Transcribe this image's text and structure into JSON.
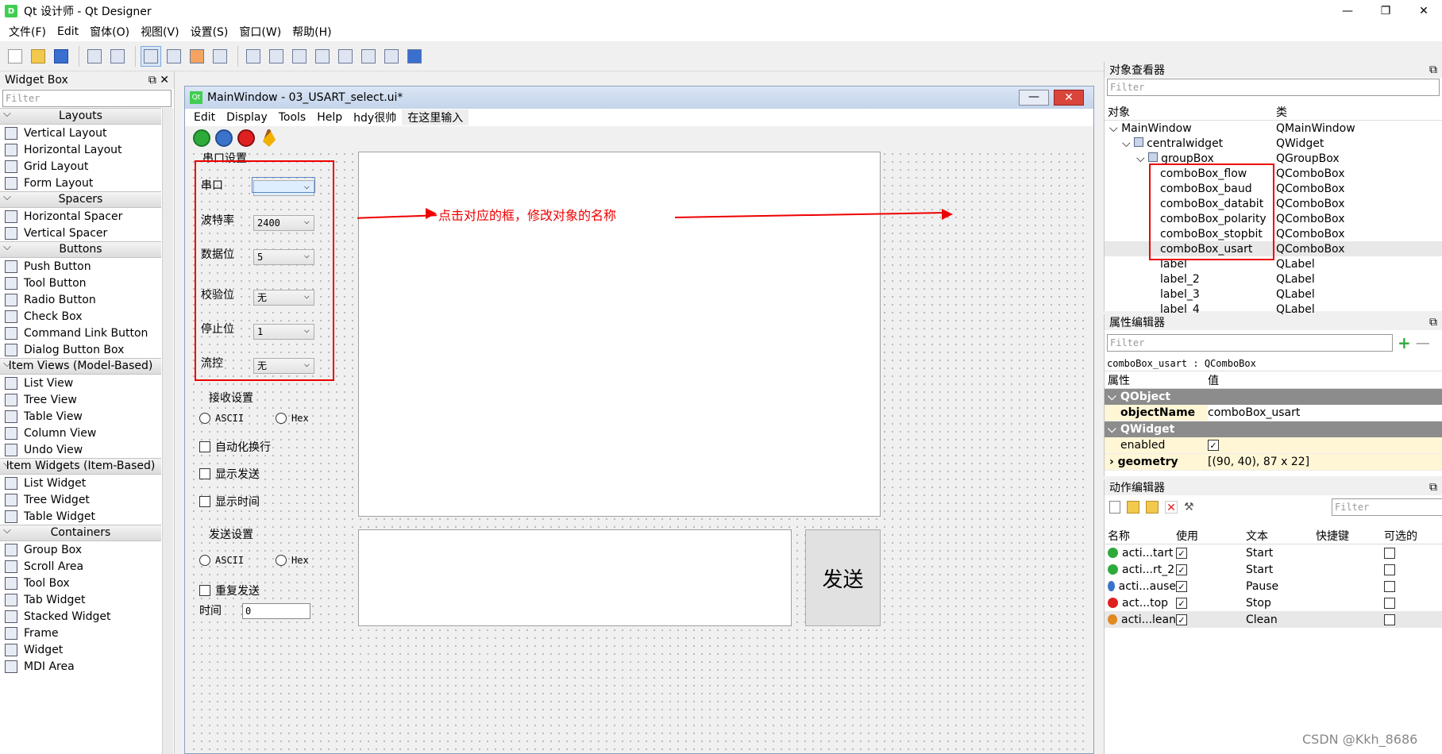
{
  "window": {
    "title": "Qt 设计师 - Qt Designer",
    "app_icon": "D",
    "minimize": "—",
    "maximize": "❐",
    "close": "✕"
  },
  "menubar": [
    "文件(F)",
    "Edit",
    "窗体(O)",
    "视图(V)",
    "设置(S)",
    "窗口(W)",
    "帮助(H)"
  ],
  "widget_box": {
    "title": "Widget Box",
    "filter": "Filter",
    "categories": [
      {
        "name": "Layouts",
        "items": [
          "Vertical Layout",
          "Horizontal Layout",
          "Grid Layout",
          "Form Layout"
        ]
      },
      {
        "name": "Spacers",
        "items": [
          "Horizontal Spacer",
          "Vertical Spacer"
        ]
      },
      {
        "name": "Buttons",
        "items": [
          "Push Button",
          "Tool Button",
          "Radio Button",
          "Check Box",
          "Command Link Button",
          "Dialog Button Box"
        ]
      },
      {
        "name": "Item Views (Model-Based)",
        "items": [
          "List View",
          "Tree View",
          "Table View",
          "Column View",
          "Undo View"
        ]
      },
      {
        "name": "Item Widgets (Item-Based)",
        "items": [
          "List Widget",
          "Tree Widget",
          "Table Widget"
        ]
      },
      {
        "name": "Containers",
        "items": [
          "Group Box",
          "Scroll Area",
          "Tool Box",
          "Tab Widget",
          "Stacked Widget",
          "Frame",
          "Widget",
          "MDI Area"
        ]
      }
    ]
  },
  "form": {
    "title": "MainWindow - 03_USART_select.ui*",
    "qt_icon": "Qt",
    "menu": [
      "Edit",
      "Display",
      "Tools",
      "Help",
      "hdy很帅",
      "在这里输入"
    ],
    "serial_group": "串口设置",
    "fields": [
      {
        "label": "串口",
        "value": ""
      },
      {
        "label": "波特率",
        "value": "2400"
      },
      {
        "label": "数据位",
        "value": "5"
      },
      {
        "label": "校验位",
        "value": "无"
      },
      {
        "label": "停止位",
        "value": "1"
      },
      {
        "label": "流控",
        "value": "无"
      }
    ],
    "recv_group": "接收设置",
    "recv_ascii": "ASCII",
    "recv_hex": "Hex",
    "auto_wrap": "自动化换行",
    "show_send": "显示发送",
    "show_time": "显示时间",
    "send_group": "发送设置",
    "send_ascii": "ASCII",
    "send_hex": "Hex",
    "repeat_send": "重复发送",
    "time_label": "时间",
    "time_value": "0",
    "send_button": "发送"
  },
  "annotation": "点击对应的框，修改对象的名称",
  "object_inspector": {
    "title": "对象查看器",
    "filter": "Filter",
    "col_object": "对象",
    "col_class": "类",
    "rows": [
      {
        "name": "MainWindow",
        "cls": "QMainWindow",
        "indent": 0
      },
      {
        "name": "centralwidget",
        "cls": "QWidget",
        "indent": 1
      },
      {
        "name": "groupBox",
        "cls": "QGroupBox",
        "indent": 2
      },
      {
        "name": "comboBox_flow",
        "cls": "QComboBox",
        "indent": 3
      },
      {
        "name": "comboBox_baud",
        "cls": "QComboBox",
        "indent": 3
      },
      {
        "name": "comboBox_databit",
        "cls": "QComboBox",
        "indent": 3
      },
      {
        "name": "comboBox_polarity",
        "cls": "QComboBox",
        "indent": 3
      },
      {
        "name": "comboBox_stopbit",
        "cls": "QComboBox",
        "indent": 3
      },
      {
        "name": "comboBox_usart",
        "cls": "QComboBox",
        "indent": 3
      },
      {
        "name": "label",
        "cls": "QLabel",
        "indent": 3
      },
      {
        "name": "label_2",
        "cls": "QLabel",
        "indent": 3
      },
      {
        "name": "label_3",
        "cls": "QLabel",
        "indent": 3
      },
      {
        "name": "label_4",
        "cls": "QLabel",
        "indent": 3
      }
    ]
  },
  "property_editor": {
    "title": "属性编辑器",
    "filter": "Filter",
    "current": "comboBox_usart : QComboBox",
    "col_prop": "属性",
    "col_val": "值",
    "group1": "QObject",
    "objectName_label": "objectName",
    "objectName_value": "comboBox_usart",
    "group2": "QWidget",
    "enabled_label": "enabled",
    "enabled_value": "✓",
    "geometry_label": "geometry",
    "geometry_value": "[(90, 40), 87 x 22]"
  },
  "action_editor": {
    "title": "动作编辑器",
    "filter": "Filter",
    "cols": [
      "名称",
      "使用",
      "文本",
      "快捷键",
      "可选的"
    ],
    "rows": [
      {
        "name": "acti...tart",
        "text": "Start",
        "color": "#2eaa3a"
      },
      {
        "name": "acti...rt_2",
        "text": "Start",
        "color": "#2eaa3a"
      },
      {
        "name": "acti...ause",
        "text": "Pause",
        "color": "#3a73c9"
      },
      {
        "name": "act...top",
        "text": "Stop",
        "color": "#e02020"
      },
      {
        "name": "acti...lean",
        "text": "Clean",
        "color": "#e08a20"
      }
    ]
  },
  "watermark": "CSDN @Kkh_8686"
}
